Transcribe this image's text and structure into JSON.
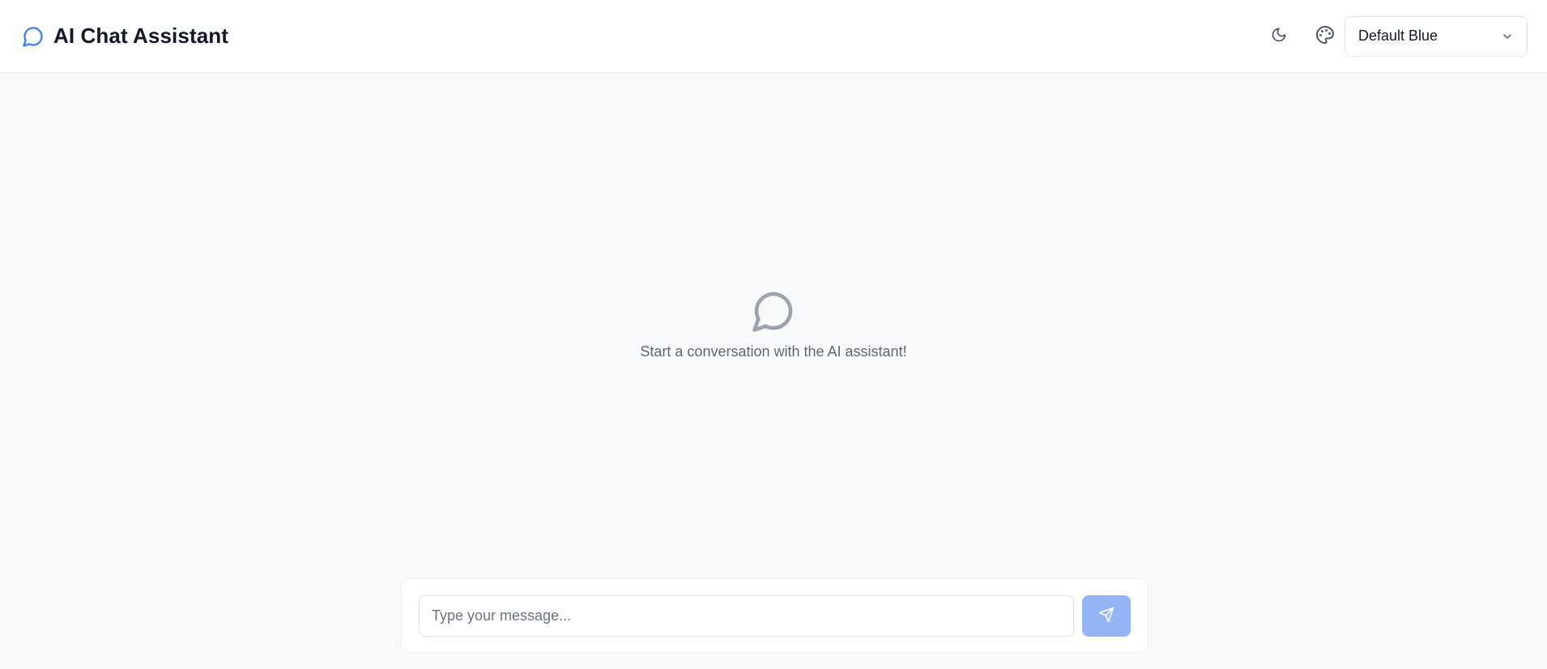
{
  "header": {
    "title": "AI Chat Assistant",
    "brand_icon": "message-circle-icon",
    "theme_toggle_icon": "moon-icon",
    "palette_icon": "palette-icon",
    "theme_select": {
      "value": "Default Blue",
      "icon": "chevron-down-icon"
    }
  },
  "empty_state": {
    "icon": "message-circle-icon",
    "text": "Start a conversation with the AI assistant!"
  },
  "composer": {
    "input_value": "",
    "placeholder": "Type your message...",
    "send_icon": "send-icon"
  },
  "colors": {
    "accent": "#3b82f6",
    "send_button_disabled": "#93b4f5",
    "background": "#f8f9fb",
    "icon_gray": "#9ca3af"
  }
}
